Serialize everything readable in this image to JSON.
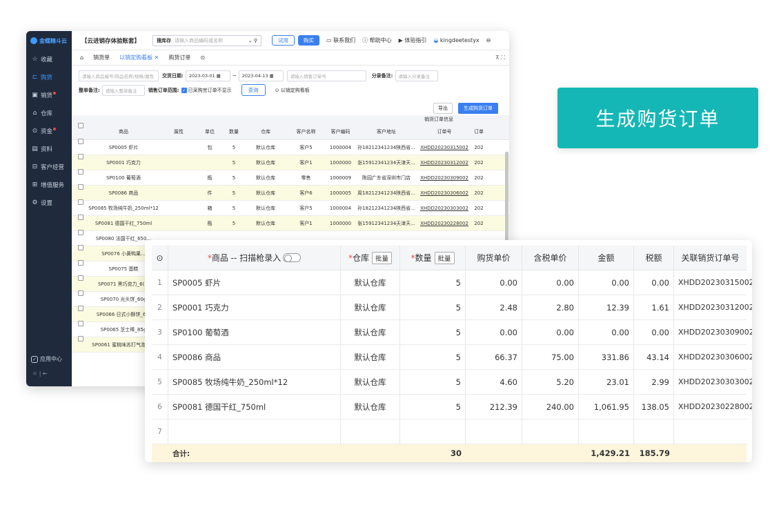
{
  "sidebar": {
    "logo": "金蝶精斗云",
    "items": [
      {
        "icon": "☆",
        "label": "收藏",
        "active": false,
        "dot": false
      },
      {
        "icon": "⊏",
        "label": "购货",
        "active": true,
        "dot": false
      },
      {
        "icon": "▣",
        "label": "销货",
        "active": false,
        "dot": true
      },
      {
        "icon": "⌂",
        "label": "仓库",
        "active": false,
        "dot": false
      },
      {
        "icon": "⊙",
        "label": "资金",
        "active": false,
        "dot": true
      },
      {
        "icon": "▤",
        "label": "资料",
        "active": false,
        "dot": false
      },
      {
        "icon": "⊟",
        "label": "客户经营",
        "active": false,
        "dot": false
      },
      {
        "icon": "⊞",
        "label": "增值服务",
        "active": false,
        "dot": false
      },
      {
        "icon": "⚙",
        "label": "设置",
        "active": false,
        "dot": false
      }
    ],
    "app_center": "应用中心",
    "bottom_icons": "☼ | ⇤"
  },
  "topbar": {
    "account": "【云进销存体验账套】",
    "search_label": "搜库存",
    "search_placeholder": "请输入商品编码或名称",
    "trial": "试用",
    "buy": "购买",
    "contact": "联系我们",
    "help": "帮助中心",
    "guide": "体验指引",
    "user": "kingdeetestyx"
  },
  "tabs": {
    "home_icon": "⌂",
    "items": [
      "销货单",
      "以销定购看板",
      "购货订单"
    ],
    "active": 1,
    "right": "⊼ ⛶"
  },
  "filters": {
    "goods_placeholder": "请输入商品编号/商品名称/规格/属性",
    "date_label": "交货日期:",
    "date_from": "2023-03-01",
    "date_to": "2023-04-13",
    "order_placeholder": "请输入销售订单号",
    "entry_note_label": "分录备注:",
    "entry_note_placeholder": "请输入分录备注",
    "whole_note_label": "整单备注:",
    "whole_note_placeholder": "请输入整单备注",
    "range_label": "销售订单范围:",
    "range_option": "已采购完订单不显示",
    "query": "查询",
    "board_link": "以销定购看板"
  },
  "grid": {
    "export": "导出",
    "generate": "生成购货订单",
    "group_title": "销货订单信息",
    "headers": [
      "商品",
      "属性",
      "单位",
      "数量",
      "仓库",
      "客户名称",
      "客户编码",
      "客户地址",
      "订单号",
      "订单"
    ],
    "rows": [
      {
        "goods": "SP0005 虾片",
        "attr": "",
        "unit": "包",
        "qty": "5",
        "wh": "默认仓库",
        "cust": "客户5",
        "code": "1000004",
        "addr": "孙18212341234陕西省...",
        "order": "XHDD20230315002",
        "date": "202",
        "y": false
      },
      {
        "goods": "SP0001 巧克力",
        "attr": "",
        "unit": "",
        "qty": "5",
        "wh": "默认仓库",
        "cust": "客户1",
        "code": "1000000",
        "addr": "张15912341234天津天...",
        "order": "XHDD20230312002",
        "date": "202",
        "y": true
      },
      {
        "goods": "SP0100 葡萄酒",
        "attr": "",
        "unit": "瓶",
        "qty": "5",
        "wh": "默认仓库",
        "cust": "零售",
        "code": "1000009",
        "addr": "陈园广东省深圳市门店",
        "order": "XHDD20230309002",
        "date": "202",
        "y": false
      },
      {
        "goods": "SP0086 商品",
        "attr": "",
        "unit": "件",
        "qty": "5",
        "wh": "默认仓库",
        "cust": "客户6",
        "code": "1000005",
        "addr": "周18212341234陕西省...",
        "order": "XHDD20230306002",
        "date": "202",
        "y": true
      },
      {
        "goods": "SP0085 牧场纯牛奶_250ml*12",
        "attr": "",
        "unit": "箱",
        "qty": "5",
        "wh": "默认仓库",
        "cust": "客户5",
        "code": "1000004",
        "addr": "孙18212341234陕西省...",
        "order": "XHDD20230303002",
        "date": "202",
        "y": false
      },
      {
        "goods": "SP0081 德国干红_750ml",
        "attr": "",
        "unit": "瓶",
        "qty": "5",
        "wh": "默认仓库",
        "cust": "客户1",
        "code": "1000000",
        "addr": "张15912341234天津天...",
        "order": "XHDD20230228002",
        "date": "202",
        "y": true
      },
      {
        "goods": "SP0080 法国干红_650...",
        "attr": "",
        "unit": "",
        "qty": "",
        "wh": "",
        "cust": "",
        "code": "",
        "addr": "",
        "order": "",
        "date": "",
        "y": false
      },
      {
        "goods": "SP0076 小黄鸭果...",
        "attr": "",
        "unit": "",
        "qty": "",
        "wh": "",
        "cust": "",
        "code": "",
        "addr": "",
        "order": "",
        "date": "",
        "y": true
      },
      {
        "goods": "SP0075 蛋糕",
        "attr": "",
        "unit": "",
        "qty": "",
        "wh": "",
        "cust": "",
        "code": "",
        "addr": "",
        "order": "",
        "date": "",
        "y": false
      },
      {
        "goods": "SP0071 黑巧克力_6(...",
        "attr": "",
        "unit": "",
        "qty": "",
        "wh": "",
        "cust": "",
        "code": "",
        "addr": "",
        "order": "",
        "date": "",
        "y": true
      },
      {
        "goods": "SP0070 光头饼_60g",
        "attr": "",
        "unit": "",
        "qty": "",
        "wh": "",
        "cust": "",
        "code": "",
        "addr": "",
        "order": "",
        "date": "",
        "y": false
      },
      {
        "goods": "SP0066 日式小酥饼_6...",
        "attr": "",
        "unit": "",
        "qty": "",
        "wh": "",
        "cust": "",
        "code": "",
        "addr": "",
        "order": "",
        "date": "",
        "y": true
      },
      {
        "goods": "SP0065 芝士棒_85g",
        "attr": "",
        "unit": "",
        "qty": "",
        "wh": "",
        "cust": "",
        "code": "",
        "addr": "",
        "order": "",
        "date": "",
        "y": false
      },
      {
        "goods": "SP0061 蜜桃味苏打气泡水...",
        "attr": "",
        "unit": "",
        "qty": "",
        "wh": "",
        "cust": "",
        "code": "",
        "addr": "",
        "order": "",
        "date": "",
        "y": true
      }
    ]
  },
  "popup": {
    "headers": {
      "goods": "商品 -- 扫描枪录入",
      "wh": "仓库",
      "qty": "数量",
      "batch": "批量",
      "price": "购货单价",
      "taxprice": "含税单价",
      "amount": "金额",
      "tax": "税额",
      "order": "关联销货订单号"
    },
    "rows": [
      {
        "no": "1",
        "goods": "SP0005 虾片",
        "wh": "默认仓库",
        "qty": "5",
        "price": "0.00",
        "taxprice": "0.00",
        "amount": "0.00",
        "tax": "0.00",
        "order": "XHDD20230315002"
      },
      {
        "no": "2",
        "goods": "SP0001 巧克力",
        "wh": "默认仓库",
        "qty": "5",
        "price": "2.48",
        "taxprice": "2.80",
        "amount": "12.39",
        "tax": "1.61",
        "order": "XHDD20230312002"
      },
      {
        "no": "3",
        "goods": "SP0100 葡萄酒",
        "wh": "默认仓库",
        "qty": "5",
        "price": "0.00",
        "taxprice": "0.00",
        "amount": "0.00",
        "tax": "0.00",
        "order": "XHDD20230309002"
      },
      {
        "no": "4",
        "goods": "SP0086 商品",
        "wh": "默认仓库",
        "qty": "5",
        "price": "66.37",
        "taxprice": "75.00",
        "amount": "331.86",
        "tax": "43.14",
        "order": "XHDD20230306002"
      },
      {
        "no": "5",
        "goods": "SP0085 牧场纯牛奶_250ml*12",
        "wh": "默认仓库",
        "qty": "5",
        "price": "4.60",
        "taxprice": "5.20",
        "amount": "23.01",
        "tax": "2.99",
        "order": "XHDD20230303002"
      },
      {
        "no": "6",
        "goods": "SP0081 德国干红_750ml",
        "wh": "默认仓库",
        "qty": "5",
        "price": "212.39",
        "taxprice": "240.00",
        "amount": "1,061.95",
        "tax": "138.05",
        "order": "XHDD20230228002"
      },
      {
        "no": "7",
        "goods": "",
        "wh": "",
        "qty": "",
        "price": "",
        "taxprice": "",
        "amount": "",
        "tax": "",
        "order": ""
      }
    ],
    "total": {
      "label": "合计:",
      "qty": "30",
      "amount": "1,429.21",
      "tax": "185.79"
    }
  },
  "cta": "生成购货订单"
}
